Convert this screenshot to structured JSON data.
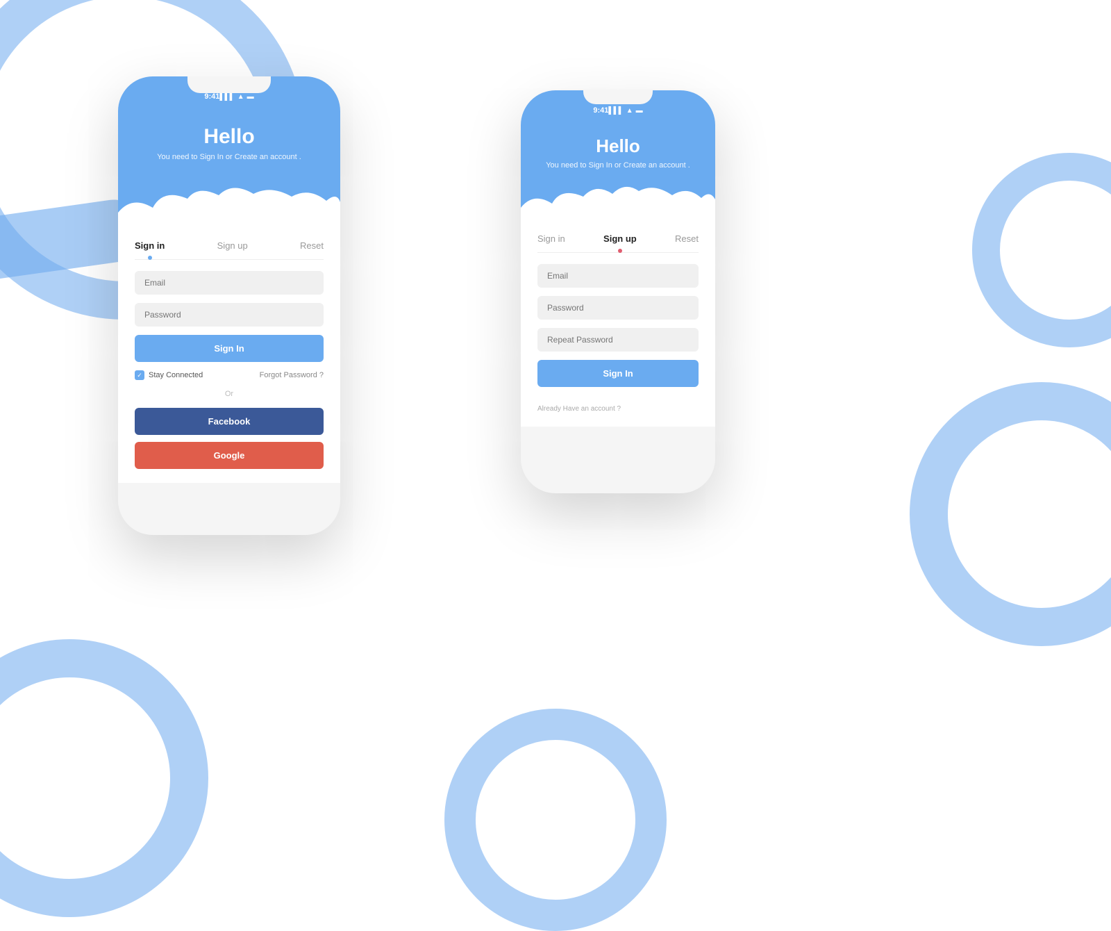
{
  "background": {
    "color": "#ffffff",
    "accent": "#6aabf0"
  },
  "phone_left": {
    "status_bar": {
      "time": "9:41",
      "icons": "▌▌▌ ▲ ▬"
    },
    "header": {
      "title": "Hello",
      "subtitle": "You need to Sign In or Create an account ."
    },
    "tabs": [
      {
        "label": "Sign in",
        "active": true,
        "dot_color": "blue"
      },
      {
        "label": "Sign up",
        "active": false
      },
      {
        "label": "Reset",
        "active": false
      }
    ],
    "fields": [
      {
        "placeholder": "Email"
      },
      {
        "placeholder": "Password"
      }
    ],
    "signin_button": "Sign In",
    "stay_connected": "Stay Connected",
    "forgot_password": "Forgot Password ?",
    "or_text": "Or",
    "facebook_button": "Facebook",
    "google_button": "Google"
  },
  "phone_right": {
    "status_bar": {
      "time": "9:41",
      "icons": "▌▌▌ ▲ ▬"
    },
    "header": {
      "title": "Hello",
      "subtitle": "You need to Sign In or Create an account ."
    },
    "tabs": [
      {
        "label": "Sign in",
        "active": false
      },
      {
        "label": "Sign up",
        "active": true,
        "dot_color": "pink"
      },
      {
        "label": "Reset",
        "active": false
      }
    ],
    "fields": [
      {
        "placeholder": "Email"
      },
      {
        "placeholder": "Password"
      },
      {
        "placeholder": "Repeat Password"
      }
    ],
    "signin_button": "Sign In",
    "already_account": "Already Have an account ?"
  }
}
